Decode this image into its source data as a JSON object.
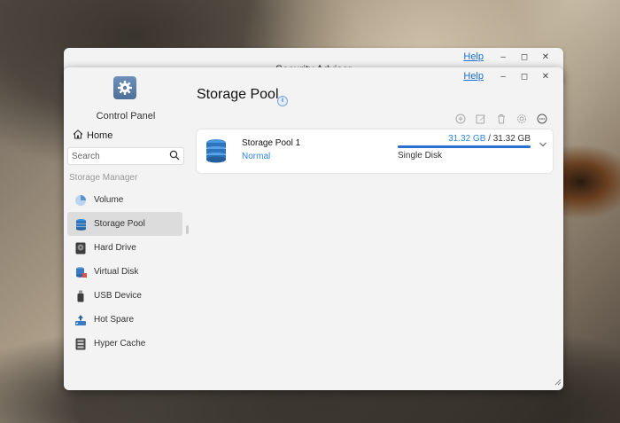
{
  "back_window": {
    "title": "Security Advisor",
    "help": "Help",
    "minimize": "–",
    "maximize": "◻",
    "close": "✕"
  },
  "main_window": {
    "help": "Help",
    "minimize": "–",
    "maximize": "◻",
    "close": "✕"
  },
  "sidebar": {
    "app_label": "Control Panel",
    "home_label": "Home",
    "search_placeholder": "Search",
    "section_label": "Storage Manager",
    "items": [
      {
        "label": "Volume",
        "icon": "volume-icon"
      },
      {
        "label": "Storage Pool",
        "icon": "storage-pool-icon",
        "active": true
      },
      {
        "label": "Hard Drive",
        "icon": "hard-drive-icon"
      },
      {
        "label": "Virtual Disk",
        "icon": "virtual-disk-icon"
      },
      {
        "label": "USB Device",
        "icon": "usb-device-icon"
      },
      {
        "label": "Hot Spare",
        "icon": "hot-spare-icon"
      },
      {
        "label": "Hyper Cache",
        "icon": "hyper-cache-icon"
      }
    ]
  },
  "main": {
    "title": "Storage Pool",
    "toolbar": [
      "add-icon",
      "edit-icon",
      "delete-icon",
      "settings-icon",
      "more-icon"
    ],
    "pool": {
      "name": "Storage Pool 1",
      "status": "Normal",
      "used": "31.32 GB",
      "separator": "/",
      "total": "31.32 GB",
      "usage_fraction": 1.0,
      "raid_type": "Single Disk"
    }
  },
  "colors": {
    "accent": "#2a84d8",
    "bar": "#2b6fd0",
    "active_nav": "#dcdcdc"
  }
}
